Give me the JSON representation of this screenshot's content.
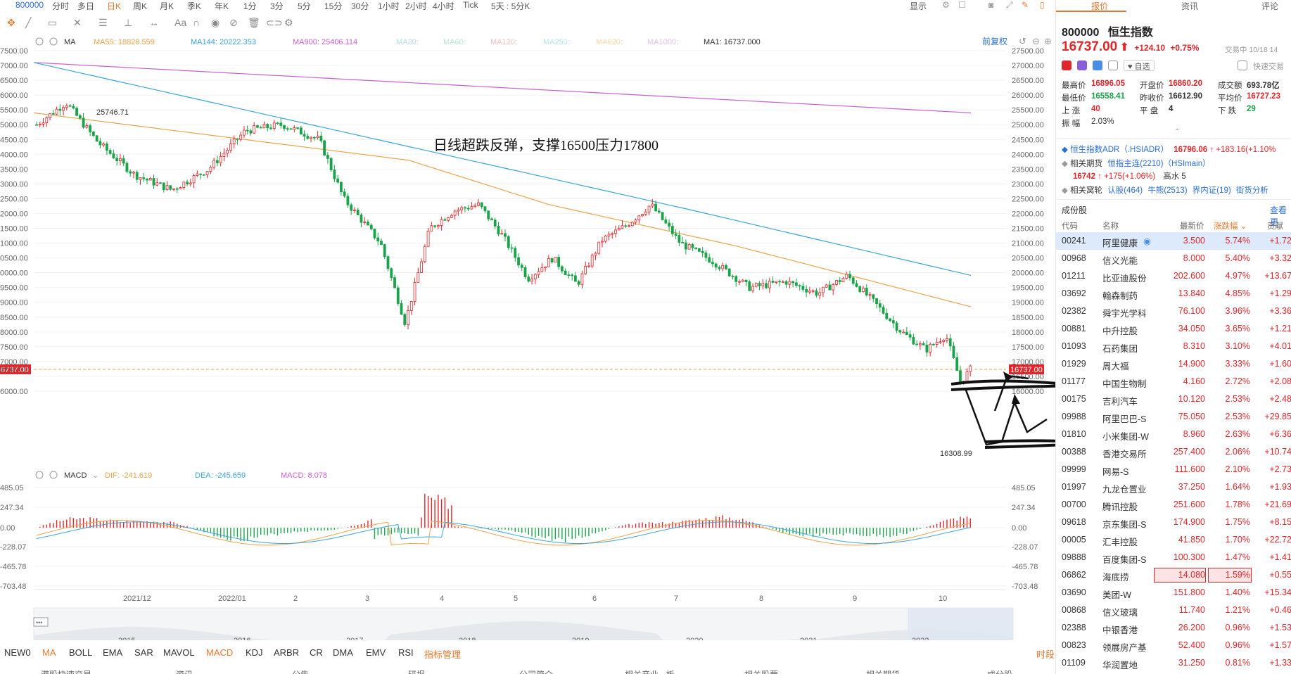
{
  "topbar": {
    "code": "800000",
    "timeframes": [
      "分时",
      "多日",
      "日K",
      "周K",
      "月K",
      "季K",
      "年K",
      "1分",
      "3分",
      "5分",
      "15分",
      "30分",
      "1小时",
      "2小时",
      "4小时",
      "Tick",
      "5天 : 5分K"
    ],
    "active": "日K",
    "display": "显示"
  },
  "ma_legend": {
    "label": "MA",
    "ma55": "MA55: 18828.559",
    "ma144": "MA144: 20222.353",
    "ma900": "MA900: 25406.114",
    "ma30": "MA30:",
    "ma60": "MA60:",
    "ma120": "MA120:",
    "ma250": "MA250:",
    "ma620": "MA620:",
    "ma1000": "MA1000:",
    "ma1": "MA1: 16737.000",
    "fq": "前复权",
    "colors": {
      "ma55": "#e8a44a",
      "ma144": "#3aa6d6",
      "ma900": "#c85fcf",
      "ma1": "#333333"
    }
  },
  "annotation": "日线超跌反弹，支撑16500压力17800",
  "price_marks": {
    "high": "25746.71",
    "low": "16308.99",
    "current": "16737.00"
  },
  "price_axis": [
    "27500.00",
    "27000.00",
    "26500.00",
    "26000.00",
    "25500.00",
    "25000.00",
    "24500.00",
    "24000.00",
    "23500.00",
    "23000.00",
    "22500.00",
    "22000.00",
    "21500.00",
    "21000.00",
    "20500.00",
    "20000.00",
    "19500.00",
    "19000.00",
    "18500.00",
    "18000.00",
    "17500.00",
    "17000.00",
    "16500.00",
    "16000.00"
  ],
  "price_axis_left": [
    "7500.00",
    "7000.00",
    "6500.00",
    "6000.00",
    "5500.00",
    "5000.00",
    "4500.00",
    "4000.00",
    "3500.00",
    "3000.00",
    "2500.00",
    "2000.00",
    "1500.00",
    "1000.00",
    "0500.00",
    "0000.00",
    "9500.00",
    "9000.00",
    "8500.00",
    "8000.00",
    "7500.00",
    "7000.00",
    "6737.00",
    "6000.00"
  ],
  "macd_legend": {
    "label": "MACD",
    "dif": "DIF: -241.619",
    "dea": "DEA: -245.659",
    "macd": "MACD: 8.078"
  },
  "macd_axis": [
    "485.05",
    "247.34",
    "0.00",
    "-228.07",
    "-465.78",
    "-703.48"
  ],
  "month_axis": [
    "2021/12",
    "2022/01",
    "2",
    "3",
    "4",
    "5",
    "6",
    "7",
    "8",
    "9",
    "10"
  ],
  "overview_years": [
    "2015",
    "2016",
    "2017",
    "2018",
    "2019",
    "2020",
    "2021",
    "2022"
  ],
  "indicator_tabs": [
    "NEW0",
    "MA",
    "BOLL",
    "EMA",
    "SAR",
    "MAVOL",
    "MACD",
    "KDJ",
    "ARBR",
    "CR",
    "DMA",
    "EMV",
    "RSI",
    "指标管理"
  ],
  "indicator_active": [
    "MA",
    "MACD"
  ],
  "period_link": "时段",
  "bottom_tabs_partial": [
    "港股快速交易",
    "资讯",
    "公告",
    "研报",
    "公司简介",
    "相关产业 · 板",
    "相关股票",
    "相关期货",
    "成分股"
  ],
  "rpanel": {
    "tabs": [
      "报价",
      "资讯",
      "评论"
    ],
    "code": "800000",
    "name": "恒生指数",
    "price": "16737.00",
    "change": "+124.10",
    "pct": "+0.75%",
    "status": "交易中 10/18 14",
    "watch": "自选",
    "quick": "快速交易",
    "stats": {
      "high_l": "最高价",
      "high": "16896.05",
      "open_l": "开盘价",
      "open": "16860.20",
      "amount_l": "成交额",
      "amount": "693.78亿",
      "low_l": "最低价",
      "low": "16558.41",
      "prev_l": "昨收价",
      "prev": "16612.90",
      "avg_l": "平均价",
      "avg": "16727.23",
      "up_l": "上  涨",
      "up": "40",
      "flat_l": "平  盘",
      "flat": "4",
      "down_l": "下  跌",
      "down": "29",
      "amp_l": "振  幅",
      "amp": "2.03%"
    },
    "adr_name": "恒生指数ADR（.HSIADR）",
    "adr_price": "16796.06",
    "adr_chg": "+183.16(+1.10%",
    "fut_label": "相关期货",
    "fut_name": "恒指主连(2210)（HSImain）",
    "fut_price": "16742",
    "fut_chg": "+175(+1.06%)",
    "fut_hw": "高水  5",
    "war_label": "相关窝轮",
    "war_items": [
      "认股(464)",
      "牛熊(2513)",
      "界内证(19)",
      "街货分析"
    ],
    "comp_title": "成份股",
    "view_more": "查看更",
    "headers": [
      "代码",
      "名称",
      "最新价",
      "涨跌幅",
      "贡献"
    ],
    "stocks": [
      {
        "code": "00241",
        "name": "阿里健康",
        "price": "3.500",
        "chg": "5.74%",
        "contrib": "+1.72"
      },
      {
        "code": "00968",
        "name": "信义光能",
        "price": "8.000",
        "chg": "5.40%",
        "contrib": "+3.32"
      },
      {
        "code": "01211",
        "name": "比亚迪股份",
        "price": "202.600",
        "chg": "4.97%",
        "contrib": "+13.67"
      },
      {
        "code": "03692",
        "name": "翰森制药",
        "price": "13.840",
        "chg": "4.85%",
        "contrib": "+1.29"
      },
      {
        "code": "02382",
        "name": "舜宇光学科",
        "price": "76.100",
        "chg": "3.96%",
        "contrib": "+3.36"
      },
      {
        "code": "00881",
        "name": "中升控股",
        "price": "34.050",
        "chg": "3.65%",
        "contrib": "+1.21"
      },
      {
        "code": "01093",
        "name": "石药集团",
        "price": "8.310",
        "chg": "3.10%",
        "contrib": "+4.01"
      },
      {
        "code": "01929",
        "name": "周大福",
        "price": "14.900",
        "chg": "3.33%",
        "contrib": "+1.60"
      },
      {
        "code": "01177",
        "name": "中国生物制",
        "price": "4.160",
        "chg": "2.72%",
        "contrib": "+2.08"
      },
      {
        "code": "00175",
        "name": "吉利汽车",
        "price": "10.120",
        "chg": "2.53%",
        "contrib": "+2.48"
      },
      {
        "code": "09988",
        "name": "阿里巴巴-S",
        "price": "75.050",
        "chg": "2.53%",
        "contrib": "+29.85"
      },
      {
        "code": "01810",
        "name": "小米集团-W",
        "price": "8.960",
        "chg": "2.63%",
        "contrib": "+6.36"
      },
      {
        "code": "00388",
        "name": "香港交易所",
        "price": "257.400",
        "chg": "2.06%",
        "contrib": "+10.74"
      },
      {
        "code": "09999",
        "name": "网易-S",
        "price": "111.600",
        "chg": "2.10%",
        "contrib": "+2.73"
      },
      {
        "code": "01997",
        "name": "九龙仓置业",
        "price": "37.250",
        "chg": "1.64%",
        "contrib": "+1.93"
      },
      {
        "code": "00700",
        "name": "腾讯控股",
        "price": "251.600",
        "chg": "1.78%",
        "contrib": "+21.69"
      },
      {
        "code": "09618",
        "name": "京东集团-S",
        "price": "174.900",
        "chg": "1.75%",
        "contrib": "+8.15"
      },
      {
        "code": "00005",
        "name": "汇丰控股",
        "price": "41.850",
        "chg": "1.70%",
        "contrib": "+22.72"
      },
      {
        "code": "09888",
        "name": "百度集团-S",
        "price": "100.300",
        "chg": "1.47%",
        "contrib": "+1.41"
      },
      {
        "code": "06862",
        "name": "海底捞",
        "price": "14.080",
        "chg": "1.59%",
        "contrib": "+0.55"
      },
      {
        "code": "03690",
        "name": "美团-W",
        "price": "151.800",
        "chg": "1.40%",
        "contrib": "+15.34"
      },
      {
        "code": "00868",
        "name": "信义玻璃",
        "price": "11.740",
        "chg": "1.21%",
        "contrib": "+0.46"
      },
      {
        "code": "02388",
        "name": "中银香港",
        "price": "26.200",
        "chg": "0.96%",
        "contrib": "+1.53"
      },
      {
        "code": "00823",
        "name": "领展房产基",
        "price": "52.400",
        "chg": "0.96%",
        "contrib": "+1.57"
      },
      {
        "code": "01109",
        "name": "华润置地",
        "price": "31.250",
        "chg": "0.81%",
        "contrib": "+1.33"
      }
    ]
  }
}
